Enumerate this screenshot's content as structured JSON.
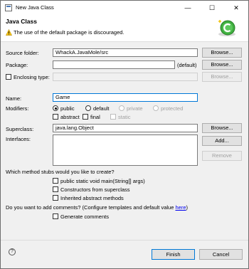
{
  "window": {
    "title": "New Java Class",
    "minimize_glyph": "—",
    "maximize_glyph": "☐",
    "close_glyph": "✕"
  },
  "header": {
    "title": "Java Class",
    "message": "The use of the default package is discouraged."
  },
  "source_folder": {
    "label": "Source folder:",
    "value": "WhackA.JavaMole/src",
    "browse": "Browse..."
  },
  "package": {
    "label": "Package:",
    "value": "",
    "default_text": "(default)",
    "browse": "Browse..."
  },
  "enclosing_type": {
    "label": "Enclosing type:",
    "value": "",
    "browse": "Browse..."
  },
  "name": {
    "label": "Name:",
    "value": "Game"
  },
  "modifiers": {
    "label": "Modifiers:",
    "public": "public",
    "default": "default",
    "private": "private",
    "protected": "protected",
    "abstract": "abstract",
    "final": "final",
    "static": "static"
  },
  "superclass": {
    "label": "Superclass:",
    "value": "java.lang.Object",
    "browse": "Browse..."
  },
  "interfaces": {
    "label": "Interfaces:",
    "add": "Add...",
    "remove": "Remove"
  },
  "stubs": {
    "question": "Which method stubs would you like to create?",
    "main": "public static void main(String[] args)",
    "constructors": "Constructors from superclass",
    "inherited": "Inherited abstract methods"
  },
  "comments": {
    "question": "Do you want to add comments? (Configure templates and default value ",
    "link": "here",
    "close_paren": ")",
    "generate": "Generate comments"
  },
  "footer": {
    "help": "?",
    "finish": "Finish",
    "cancel": "Cancel"
  }
}
